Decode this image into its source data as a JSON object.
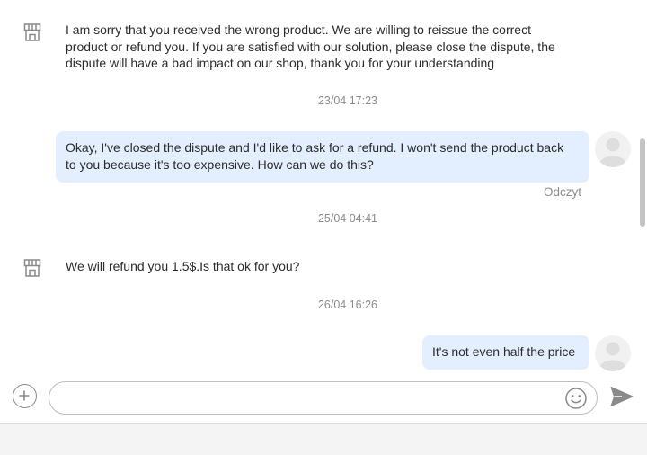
{
  "messages": [
    {
      "from": "shop",
      "lines": [
        "I am sorry that you received the wrong product. We are willing to reissue the correct",
        "product or refund you. If you are satisfied with our solution, please close the dispute, the",
        "dispute will have a bad impact on our shop, thank you for your understanding"
      ]
    },
    {
      "timestamp": "23/04 17:23"
    },
    {
      "from": "user",
      "lines": [
        "Okay, I've closed the dispute and I'd like to ask for a refund. I won't send the product back",
        "to you because it's too expensive. How can we do this?"
      ],
      "status": "Odczyt"
    },
    {
      "timestamp": "25/04 04:41"
    },
    {
      "from": "shop",
      "text": "We will refund you 1.5$.Is that ok for you?"
    },
    {
      "timestamp": "26/04 16:26"
    },
    {
      "from": "user",
      "text": "It's not even half the price"
    }
  ],
  "composer": {
    "value": ""
  },
  "icons": {
    "shop": "shop-icon",
    "avatar": "user-avatar-icon",
    "add": "plus-icon",
    "emoji": "smiley-icon",
    "send": "send-icon"
  },
  "colors": {
    "user_bubble": "#e3efff",
    "timestamp": "#8c8c8c",
    "icon": "#8a8a8a"
  }
}
